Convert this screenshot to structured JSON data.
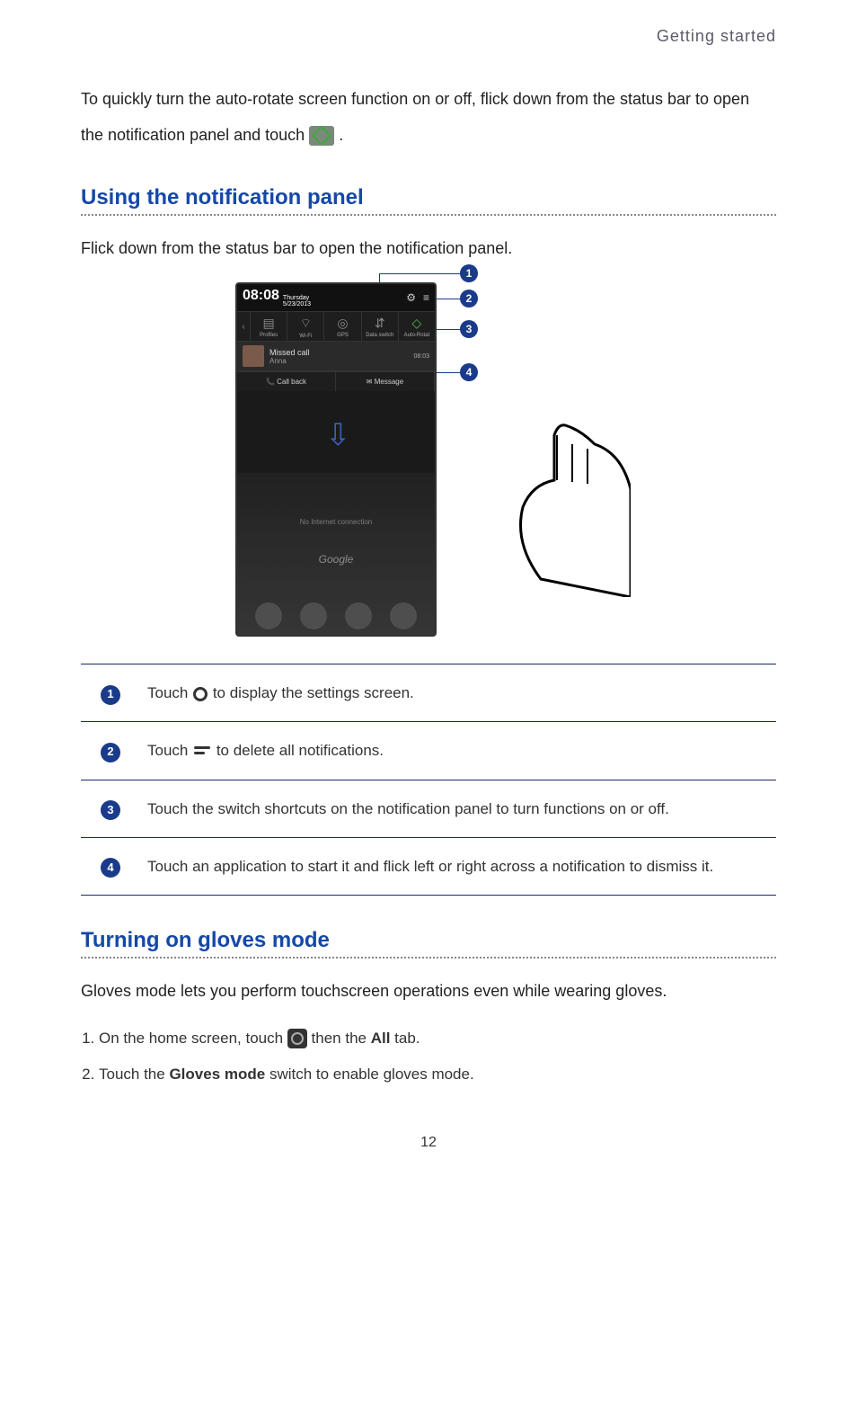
{
  "header": {
    "chapter": "Getting started"
  },
  "intro": {
    "part1": "To quickly turn the auto-rotate screen function on or off, flick down from the status bar to open the notification panel and touch ",
    "part2": " ."
  },
  "section1": {
    "heading": "Using the notification panel",
    "lead": "Flick down from the status bar to open the notification panel."
  },
  "phone": {
    "time": "08:08",
    "day": "Thursday",
    "date": "5/23/2013",
    "toggles": [
      {
        "label": "Profiles"
      },
      {
        "label": "Wi-Fi"
      },
      {
        "label": "GPS"
      },
      {
        "label": "Data switch"
      },
      {
        "label": "Auto-Rotat"
      }
    ],
    "notif": {
      "title": "Missed call",
      "caller": "Anna",
      "time": "08:03",
      "action1": "Call back",
      "action2": "Message"
    },
    "noInternet": "No Internet connection",
    "google": "Google"
  },
  "callouts": [
    "1",
    "2",
    "3",
    "4"
  ],
  "legend": [
    {
      "num": "1",
      "pre": "Touch ",
      "post": " to display the settings screen."
    },
    {
      "num": "2",
      "pre": "Touch ",
      "post": " to delete all notifications."
    },
    {
      "num": "3",
      "text": "Touch the switch shortcuts on the notification panel to turn functions on or off."
    },
    {
      "num": "4",
      "text": "Touch an application to start it and flick left or right across a notification to dismiss it."
    }
  ],
  "section2": {
    "heading": "Turning on gloves mode",
    "lead": "Gloves mode lets you perform touchscreen operations even while wearing gloves.",
    "step1_pre": "On the home screen, touch ",
    "step1_mid": " then the ",
    "step1_bold": "All",
    "step1_post": " tab.",
    "step2_pre": "Touch the ",
    "step2_bold": "Gloves mode",
    "step2_post": " switch to enable gloves mode."
  },
  "pageNumber": "12"
}
